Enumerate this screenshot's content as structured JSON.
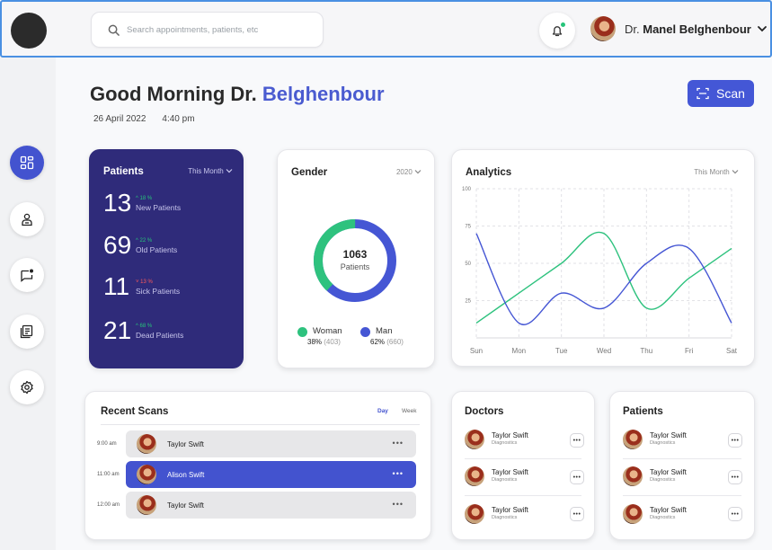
{
  "header": {
    "search_placeholder": "Search appointments, patients, etc",
    "user_prefix": "Dr.",
    "user_name": "Manel Belghenbour"
  },
  "sidebar": {
    "items": [
      {
        "name": "dashboard",
        "active": true
      },
      {
        "name": "patient"
      },
      {
        "name": "messages"
      },
      {
        "name": "records"
      },
      {
        "name": "settings"
      }
    ]
  },
  "greeting": {
    "text": "Good Morning Dr.",
    "name": "Belghenbour",
    "date": "26 April 2022",
    "time": "4:40 pm"
  },
  "scan_button": "Scan",
  "patients_card": {
    "title": "Patients",
    "period": "This Month",
    "stats": [
      {
        "value": "13",
        "change": "^ 18 %",
        "label": "New Patients",
        "color": "#27c47a"
      },
      {
        "value": "69",
        "change": "^ 22 %",
        "label": "Old Patients",
        "color": "#27c47a"
      },
      {
        "value": "11",
        "change": "˅ 13 %",
        "label": "Sick Patients",
        "color": "#ff5a5a"
      },
      {
        "value": "21",
        "change": "^ 68 %",
        "label": "Dead Patients",
        "color": "#27c47a"
      }
    ]
  },
  "gender_card": {
    "title": "Gender",
    "year": "2020",
    "total": "1063",
    "total_label": "Patients",
    "woman_label": "Woman",
    "woman_pct": "38%",
    "woman_count": "(403)",
    "man_label": "Man",
    "man_pct": "62%",
    "man_count": "(660)",
    "woman_color": "#2ec27e",
    "man_color": "#4556d4",
    "woman_fraction": 0.38
  },
  "analytics_card": {
    "title": "Analytics",
    "period": "This Month"
  },
  "chart_data": {
    "type": "line",
    "categories": [
      "Sun",
      "Mon",
      "Tue",
      "Wed",
      "Thu",
      "Fri",
      "Sat"
    ],
    "yticks": [
      100,
      75,
      50,
      25
    ],
    "ylim": [
      0,
      100
    ],
    "grid": true,
    "series": [
      {
        "color": "#2ec27e",
        "values": [
          10,
          30,
          50,
          70,
          20,
          40,
          60
        ]
      },
      {
        "color": "#4556d4",
        "values": [
          70,
          10,
          30,
          20,
          50,
          60,
          10
        ]
      }
    ]
  },
  "recent_scans": {
    "title": "Recent Scans",
    "tab_day": "Day",
    "tab_week": "Week",
    "rows": [
      {
        "time": "9:00 am",
        "name": "Taylor Swift",
        "active": false
      },
      {
        "time": "11:00 am",
        "name": "Alison Swift",
        "active": true
      },
      {
        "time": "12:00 am",
        "name": "Taylor Swift",
        "active": false
      }
    ]
  },
  "doctors": {
    "title": "Doctors",
    "items": [
      {
        "name": "Taylor Swift",
        "role": "Diagnostics"
      },
      {
        "name": "Taylor Swift",
        "role": "Diagnostics"
      },
      {
        "name": "Taylor Swift",
        "role": "Diagnostics"
      }
    ]
  },
  "patients_list": {
    "title": "Patients",
    "items": [
      {
        "name": "Taylor Swift",
        "role": "Diagnostics"
      },
      {
        "name": "Taylor Swift",
        "role": "Diagnostics"
      },
      {
        "name": "Taylor Swift",
        "role": "Diagnostics"
      }
    ]
  },
  "more_label": "•••"
}
